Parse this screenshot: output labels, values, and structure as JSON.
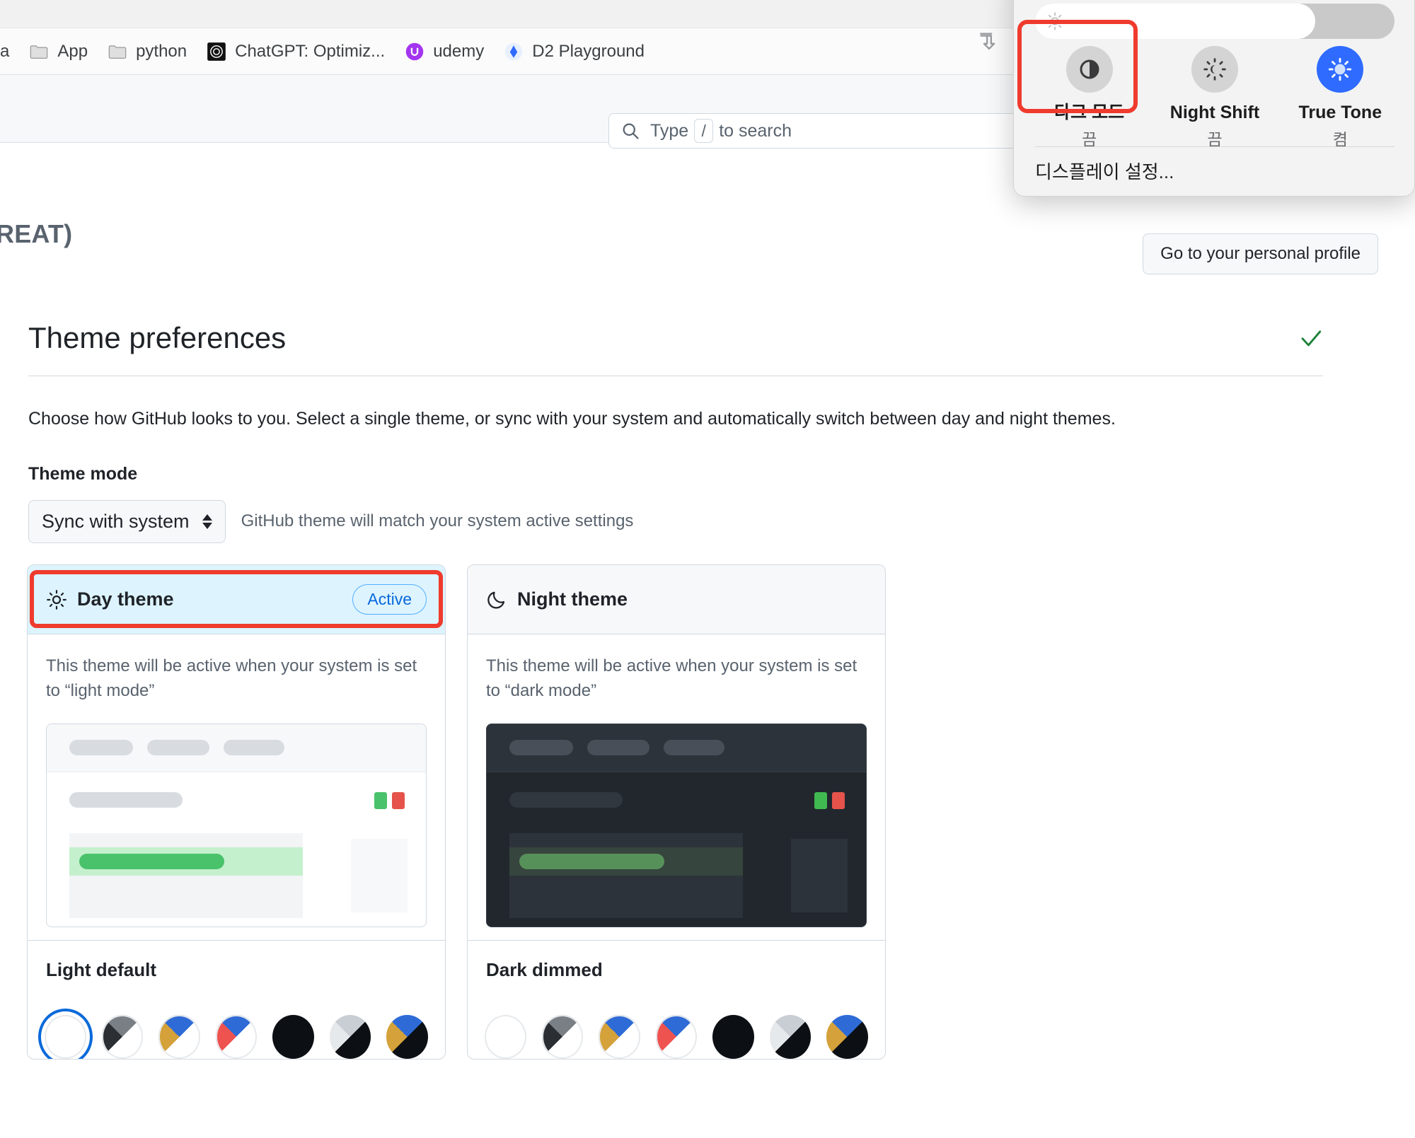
{
  "browser": {
    "bookmarks": [
      {
        "label": "a",
        "icon": "text-bookmark-icon"
      },
      {
        "label": "App",
        "icon": "folder-icon"
      },
      {
        "label": "python",
        "icon": "folder-icon"
      },
      {
        "label": "ChatGPT: Optimiz...",
        "icon": "chatgpt-icon"
      },
      {
        "label": "udemy",
        "icon": "udemy-icon"
      },
      {
        "label": "D2 Playground",
        "icon": "d2-icon"
      }
    ],
    "download_icon": "download-icon"
  },
  "github": {
    "search": {
      "placeholder_prefix": "Type",
      "kbd": "/",
      "placeholder_suffix": "to search",
      "icon": "search-icon"
    },
    "page_title_partial": "REAT)",
    "profile_button": "Go to your personal profile",
    "section": {
      "title": "Theme preferences",
      "saved_icon": "check-icon",
      "description": "Choose how GitHub looks to you. Select a single theme, or sync with your system and automatically switch between day and night themes.",
      "field_label": "Theme mode",
      "mode_value": "Sync with system",
      "mode_hint": "GitHub theme will match your system active settings"
    },
    "cards": [
      {
        "kind": "day",
        "icon": "sun-icon",
        "title": "Day theme",
        "badge": "Active",
        "description": "This theme will be active when your system is set to “light mode”",
        "theme_name": "Light default",
        "selected_swatch": 0,
        "swatches": [
          "light-default",
          "light-high-contrast",
          "light-colorblind",
          "light-tritanopia",
          "dark-default",
          "dark-high-contrast",
          "dark-colorblind"
        ]
      },
      {
        "kind": "night",
        "icon": "moon-icon",
        "title": "Night theme",
        "badge": "",
        "description": "This theme will be active when your system is set to “dark mode”",
        "theme_name": "Dark dimmed",
        "selected_swatch": -1,
        "swatches": [
          "light-default",
          "light-high-contrast",
          "light-colorblind",
          "light-tritanopia",
          "dark-default",
          "dark-high-contrast",
          "dark-colorblind"
        ]
      }
    ]
  },
  "control_center": {
    "brightness_icon": "brightness-icon",
    "brightness_percent": 78,
    "tiles": [
      {
        "label": "다크 모드",
        "state": "끔",
        "icon": "dark-mode-icon",
        "on": false
      },
      {
        "label": "Night Shift",
        "state": "끔",
        "icon": "night-shift-icon",
        "on": false
      },
      {
        "label": "True Tone",
        "state": "켬",
        "icon": "true-tone-icon",
        "on": true
      }
    ],
    "settings_link": "디스플레이 설정..."
  },
  "colors": {
    "highlight_red": "#ef3b2d",
    "accent_blue": "#0969da",
    "active_badge_border": "#54aeff",
    "day_header_bg": "#ddf4ff",
    "true_tone_blue": "#2f6bff",
    "preview_green": "#4ac26b",
    "preview_red": "#e5534b"
  }
}
